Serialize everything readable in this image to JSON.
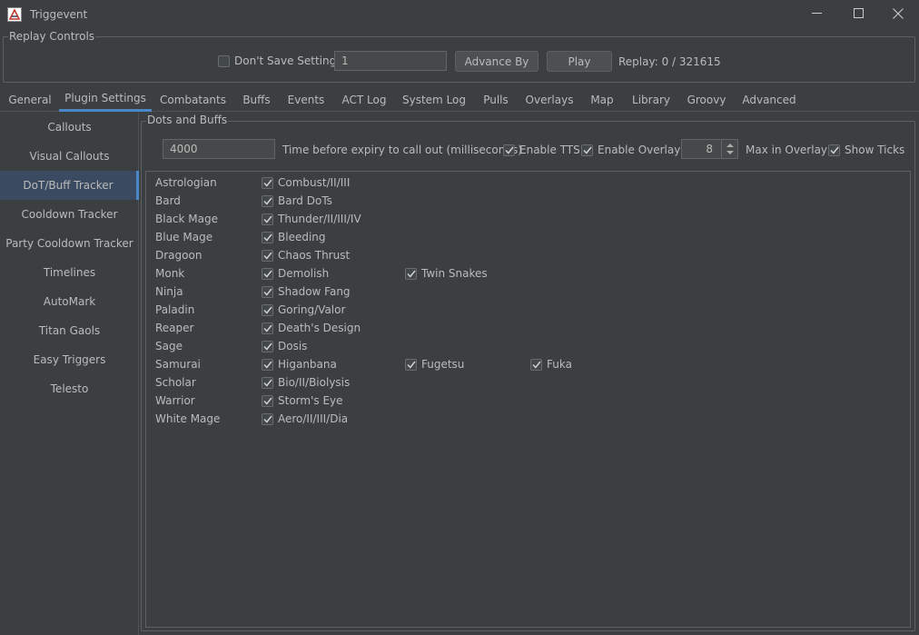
{
  "window": {
    "title": "Triggevent",
    "icons": {
      "app": "app-logo-icon",
      "minimize": "minimize-icon",
      "maximize": "maximize-icon",
      "close": "close-icon"
    }
  },
  "replay_controls": {
    "legend": "Replay Controls",
    "dont_save_label": "Don't Save Settings",
    "dont_save_checked": false,
    "advance_value": "1",
    "advance_button": "Advance By",
    "play_button": "Play",
    "replay_status": "Replay: 0 / 321615"
  },
  "tabs": [
    "General",
    "Plugin Settings",
    "Combatants",
    "Buffs",
    "Events",
    "ACT Log",
    "System Log",
    "Pulls",
    "Overlays",
    "Map",
    "Library",
    "Groovy",
    "Advanced"
  ],
  "active_tab": "Plugin Settings",
  "sidebar": {
    "items": [
      "Callouts",
      "Visual Callouts",
      "DoT/Buff Tracker",
      "Cooldown Tracker",
      "Party Cooldown Tracker",
      "Timelines",
      "AutoMark",
      "Titan Gaols",
      "Easy Triggers",
      "Telesto"
    ],
    "active": "DoT/Buff Tracker"
  },
  "dots": {
    "legend": "Dots and Buffs",
    "expiry_value": "4000",
    "expiry_label": "Time before expiry to call out (milliseconds)",
    "enable_tts_label": "Enable TTS",
    "enable_tts_checked": true,
    "enable_overlay_label": "Enable Overlay",
    "enable_overlay_checked": true,
    "max_overlay_value": "8",
    "max_overlay_label": "Max in Overlay",
    "show_ticks_label": "Show Ticks",
    "show_ticks_checked": true,
    "jobs": [
      {
        "job": "Astrologian",
        "buffs": [
          "Combust/II/III"
        ]
      },
      {
        "job": "Bard",
        "buffs": [
          "Bard DoTs"
        ]
      },
      {
        "job": "Black Mage",
        "buffs": [
          "Thunder/II/III/IV"
        ]
      },
      {
        "job": "Blue Mage",
        "buffs": [
          "Bleeding"
        ]
      },
      {
        "job": "Dragoon",
        "buffs": [
          "Chaos Thrust"
        ]
      },
      {
        "job": "Monk",
        "buffs": [
          "Demolish",
          "Twin Snakes"
        ]
      },
      {
        "job": "Ninja",
        "buffs": [
          "Shadow Fang"
        ]
      },
      {
        "job": "Paladin",
        "buffs": [
          "Goring/Valor"
        ]
      },
      {
        "job": "Reaper",
        "buffs": [
          "Death's Design"
        ]
      },
      {
        "job": "Sage",
        "buffs": [
          "Dosis"
        ]
      },
      {
        "job": "Samurai",
        "buffs": [
          "Higanbana",
          "Fugetsu",
          "Fuka"
        ]
      },
      {
        "job": "Scholar",
        "buffs": [
          "Bio/II/Biolysis"
        ]
      },
      {
        "job": "Warrior",
        "buffs": [
          "Storm's Eye"
        ]
      },
      {
        "job": "White Mage",
        "buffs": [
          "Aero/II/III/Dia"
        ]
      }
    ]
  }
}
